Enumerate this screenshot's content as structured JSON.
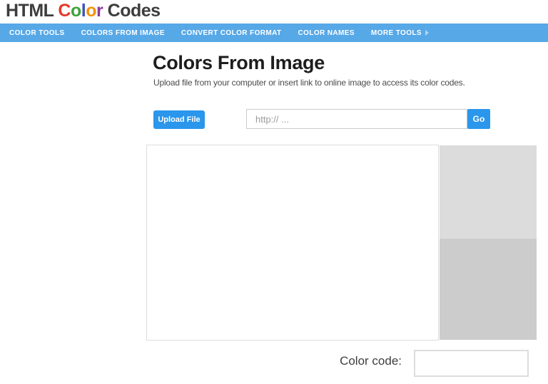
{
  "logo": {
    "part1": "HTML ",
    "colored_word": [
      {
        "char": "C",
        "color": "#e23b2e"
      },
      {
        "char": "o",
        "color": "#3fa33f"
      },
      {
        "char": "l",
        "color": "#3f51b5"
      },
      {
        "char": "o",
        "color": "#f3920c"
      },
      {
        "char": "r",
        "color": "#8e3a9d"
      }
    ],
    "part2": " Codes",
    "text_color": "#3d3d3d"
  },
  "nav": {
    "bg_color": "#57a8e7",
    "items": [
      {
        "label": "COLOR TOOLS"
      },
      {
        "label": "COLORS FROM IMAGE"
      },
      {
        "label": "CONVERT COLOR FORMAT"
      },
      {
        "label": "COLOR NAMES"
      },
      {
        "label": "MORE TOOLS"
      }
    ]
  },
  "content": {
    "title": "Colors From Image",
    "subtitle": "Upload file from your computer or insert link to online image to access its color codes.",
    "upload_button_label": "Upload File",
    "url_input_placeholder": "http:// ...",
    "url_input_value": "",
    "go_button_label": "Go",
    "button_color": "#2a96ec"
  },
  "workspace": {
    "canvas_bg": "#ffffff",
    "palette_swatches": [
      {
        "name": "swatch-1",
        "color": "#dcdcdc"
      },
      {
        "name": "swatch-2",
        "color": "#cccccc"
      }
    ]
  },
  "color_code": {
    "label": "Color code:",
    "value": ""
  }
}
